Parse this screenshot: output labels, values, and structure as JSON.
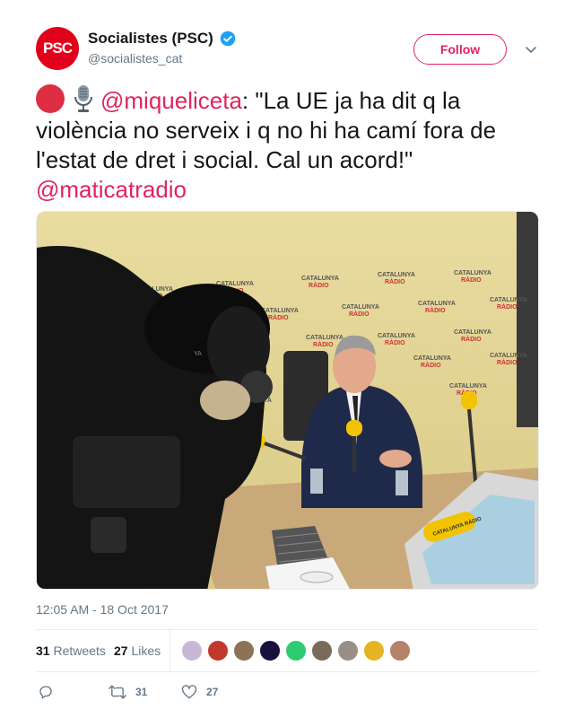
{
  "account": {
    "avatar_text": "PSC",
    "display_name": "Socialistes (PSC)",
    "handle": "@socialistes_cat",
    "verified": true,
    "brand_color": "#e3001b"
  },
  "header": {
    "follow_label": "Follow",
    "menu_icon": "chevron-down-icon"
  },
  "tweet": {
    "mention_1": "@miqueliceta",
    "body": ": \"La UE ja ha dit q la violència no serveix i q no hi ha camí fora de l'estat de dret i social. Cal un acord!\"",
    "mention_2": "@maticatradio",
    "emoji": [
      "red-circle-icon",
      "microphone-icon"
    ],
    "accent_color": "#e0245e"
  },
  "media": {
    "backdrop_text": "CATALUNYA RADIO",
    "mic_flag_text": "CATALUNYA RADIO",
    "alt": "photo"
  },
  "timestamp": "12:05 AM - 18 Oct 2017",
  "stats": {
    "retweets_count": "31",
    "retweets_label": "Retweets",
    "likes_count": "27",
    "likes_label": "Likes"
  },
  "actions": {
    "reply_icon": "reply-icon",
    "retweet_icon": "retweet-icon",
    "retweet_count": "31",
    "like_icon": "heart-icon",
    "like_count": "27"
  }
}
